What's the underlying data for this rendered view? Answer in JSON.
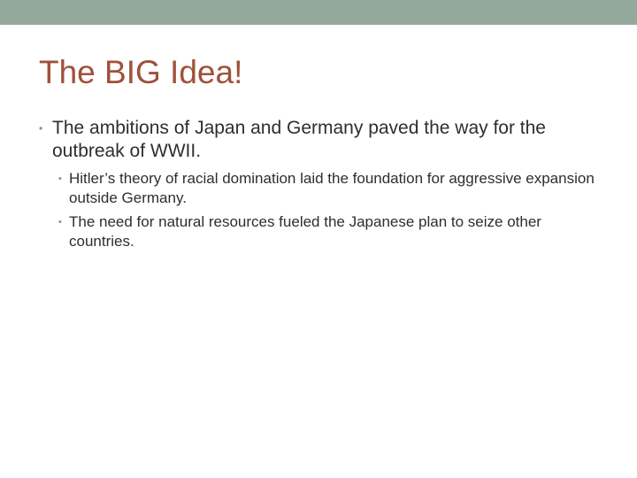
{
  "slide": {
    "title": "The BIG Idea!",
    "bullets": [
      {
        "text": "The ambitions of Japan and Germany paved the way for the outbreak of WWII.",
        "sub": [
          "Hitler’s theory of racial domination laid the foundation for aggressive expansion outside Germany.",
          "The need for natural resources fueled the Japanese plan to seize other countries."
        ]
      }
    ],
    "bullet_glyph": "•"
  },
  "colors": {
    "top_band": "#94a89c",
    "title": "#a0513a",
    "body_text": "#2e2e2e",
    "bullet": "#8a8a8a",
    "background": "#ffffff"
  }
}
